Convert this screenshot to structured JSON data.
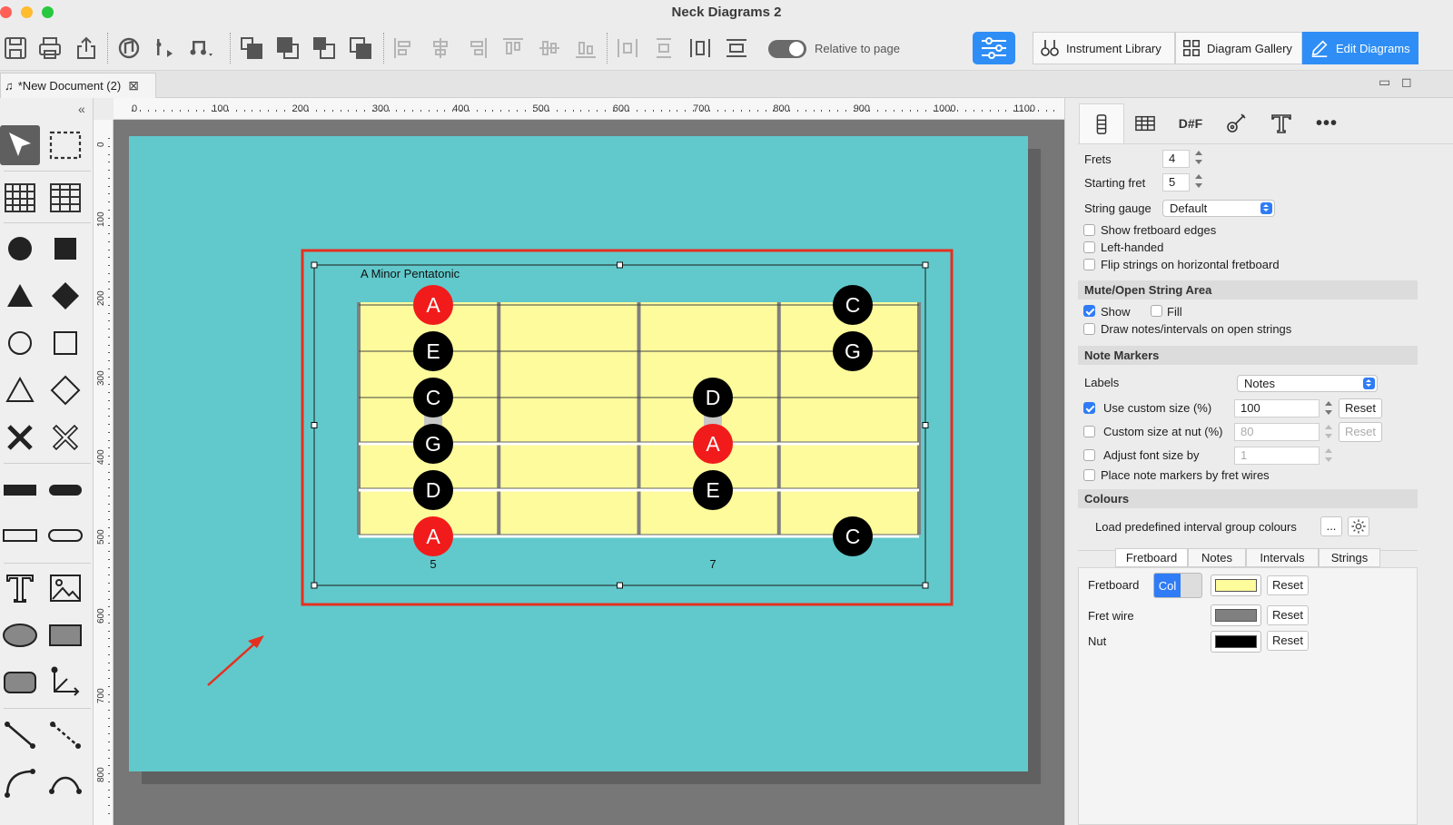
{
  "window": {
    "title": "Neck Diagrams 2"
  },
  "toolbar": {
    "relative_toggle_label": "Relative to page",
    "relative_toggle_on": true,
    "instrument_library": "Instrument Library",
    "diagram_gallery": "Diagram Gallery",
    "edit_diagrams": "Edit Diagrams"
  },
  "document_tab": {
    "label": "*New Document (2)"
  },
  "ruler": {
    "h_labels": [
      "0",
      "100",
      "200",
      "300",
      "400",
      "500",
      "600",
      "700",
      "800",
      "900",
      "1000",
      "1100"
    ],
    "v_labels": [
      "0",
      "100",
      "200",
      "300",
      "400",
      "500",
      "600",
      "700",
      "800"
    ]
  },
  "diagram": {
    "title": "A Minor Pentatonic",
    "fret_numbers": [
      "5",
      "7"
    ],
    "colors": {
      "page": "#61c9cb",
      "fretboard": "#fdfb9c",
      "root": "#f21b1b",
      "note": "#000000",
      "selection": "#e53020"
    },
    "markers": [
      {
        "label": "A",
        "string": 0,
        "fret": 0,
        "root": true
      },
      {
        "label": "E",
        "string": 1,
        "fret": 0,
        "root": false
      },
      {
        "label": "C",
        "string": 2,
        "fret": 0,
        "root": false
      },
      {
        "label": "G",
        "string": 3,
        "fret": 0,
        "root": false
      },
      {
        "label": "D",
        "string": 4,
        "fret": 0,
        "root": false
      },
      {
        "label": "A",
        "string": 5,
        "fret": 0,
        "root": true
      },
      {
        "label": "D",
        "string": 2,
        "fret": 2,
        "root": false
      },
      {
        "label": "A",
        "string": 3,
        "fret": 2,
        "root": true
      },
      {
        "label": "E",
        "string": 4,
        "fret": 2,
        "root": false
      },
      {
        "label": "C",
        "string": 0,
        "fret": 3.5,
        "root": false
      },
      {
        "label": "G",
        "string": 1,
        "fret": 3.5,
        "root": false
      },
      {
        "label": "C",
        "string": 5,
        "fret": 3.5,
        "root": false
      }
    ]
  },
  "inspector": {
    "tabs_text": [
      "D#F"
    ],
    "frets": {
      "label": "Frets",
      "value": "4"
    },
    "starting_fret": {
      "label": "Starting fret",
      "value": "5"
    },
    "string_gauge": {
      "label": "String gauge",
      "value": "Default"
    },
    "show_fretboard_edges": "Show fretboard edges",
    "left_handed": "Left-handed",
    "flip_strings": "Flip strings on horizontal fretboard",
    "mute_section": "Mute/Open String Area",
    "mute_show": "Show",
    "mute_fill": "Fill",
    "draw_open": "Draw notes/intervals on open strings",
    "markers_section": "Note Markers",
    "labels": {
      "label": "Labels",
      "value": "Notes"
    },
    "use_custom_size": {
      "label": "Use custom size (%)",
      "value": "100",
      "reset": "Reset"
    },
    "custom_size_nut": {
      "label": "Custom size at nut (%)",
      "value": "80",
      "reset": "Reset"
    },
    "adjust_font": {
      "label": "Adjust font size by",
      "value": "1"
    },
    "place_by_fret": "Place note markers by fret wires",
    "colours_section": "Colours",
    "load_predefined": "Load predefined interval group colours",
    "load_button": "...",
    "colour_tabs": [
      "Fretboard",
      "Notes",
      "Intervals",
      "Strings"
    ],
    "fretboard_color": {
      "label": "Fretboard",
      "col": "Col",
      "reset": "Reset",
      "color": "#fdfb9c"
    },
    "fret_wire_color": {
      "label": "Fret wire",
      "reset": "Reset",
      "color": "#808080"
    },
    "nut_color": {
      "label": "Nut",
      "reset": "Reset",
      "color": "#000000"
    }
  }
}
